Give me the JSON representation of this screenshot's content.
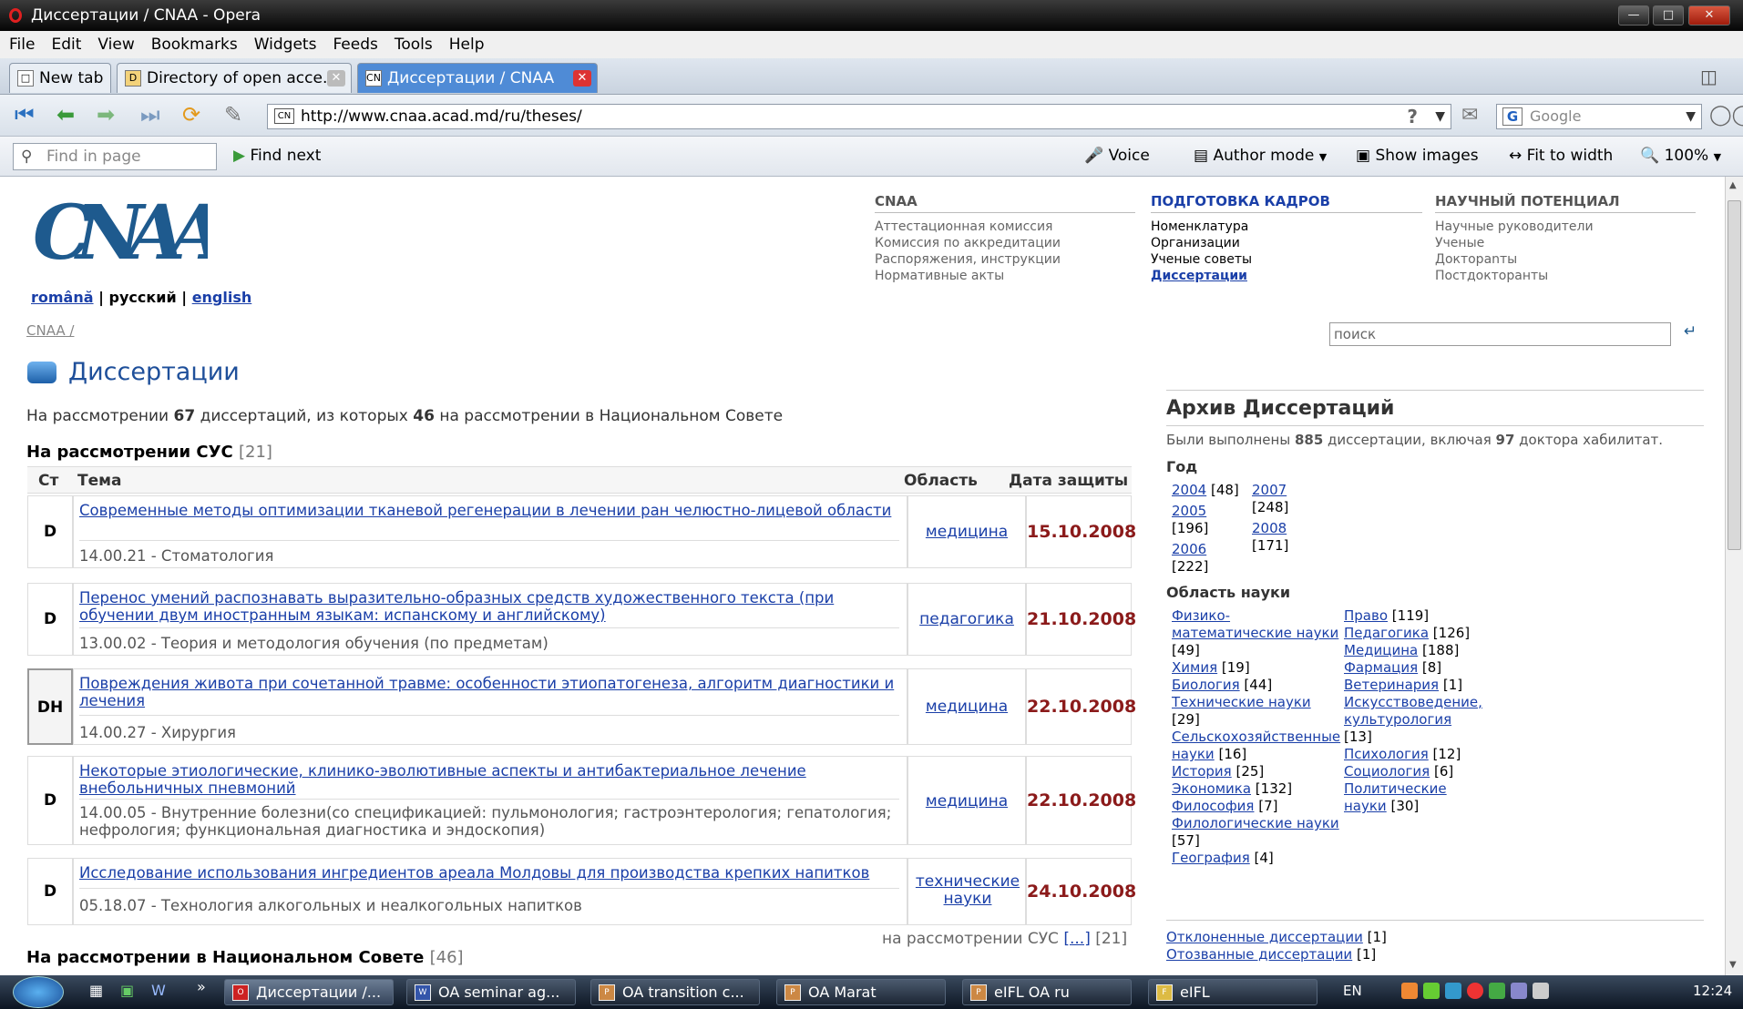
{
  "window": {
    "title": "Диссертации / CNAA - Opera"
  },
  "menu": [
    "File",
    "Edit",
    "View",
    "Bookmarks",
    "Widgets",
    "Feeds",
    "Tools",
    "Help"
  ],
  "tabs": [
    {
      "label": "New tab"
    },
    {
      "label": "Directory of open acce..."
    },
    {
      "label": "Диссертации / CNAA"
    }
  ],
  "nav": {
    "url": "http://www.cnaa.acad.md/ru/theses/",
    "search_placeholder": "Google"
  },
  "findbar": {
    "find_placeholder": "Find in page",
    "find_next": "Find next",
    "voice": "Voice",
    "author_mode": "Author mode",
    "show_images": "Show images",
    "fit_to_width": "Fit to width",
    "zoom": "100%"
  },
  "site": {
    "logo": "CNAA",
    "languages": {
      "ro": "română",
      "ru": "русский",
      "en": "english"
    },
    "breadcrumb": "CNAA /",
    "search_placeholder": "поиск",
    "menu_cols": [
      {
        "heading": "CNAA",
        "items": [
          "Аттестационная комиссия",
          "Комиссия по аккредитации",
          "Распоряжения, инструкции",
          "Нормативные акты"
        ]
      },
      {
        "heading": "ПОДГОТОВКА КАДРОВ",
        "items": [
          "Номенклатура",
          "Организации",
          "Ученые советы",
          "Диссертации"
        ]
      },
      {
        "heading": "НАУЧНЫЙ ПОТЕНЦИАЛ",
        "items": [
          "Научные руководители",
          "Ученые",
          "Доктораnты",
          "Постдокторанты"
        ]
      }
    ]
  },
  "main": {
    "title": "Диссертации",
    "summary": {
      "pre": "На рассмотрении ",
      "total": "67",
      "mid": " диссертаций, из которых ",
      "nc": "46",
      "post": " на рассмотрении в Национальном Совете"
    },
    "section1": {
      "title": "На рассмотрении СУС",
      "count": "[21]"
    },
    "columns": {
      "st": "Ст",
      "topic": "Тема",
      "area": "Область",
      "date": "Дата защиты"
    },
    "rows": [
      {
        "st": "D",
        "topic": "Современные методы оптимизации тканевой регенерации в лечении ран челюстно-лицевой области",
        "spec": "14.00.21 - Стоматология",
        "area": "медицина",
        "date": "15.10.2008"
      },
      {
        "st": "D",
        "topic": "Перенос умений распознавать выразительно-образных средств художественного текста (при обучении двум иностранным языкам: испанскому и английскому)",
        "spec": "13.00.02 - Теория и методология обучения (по предметам)",
        "area": "педагогика",
        "date": "21.10.2008"
      },
      {
        "st": "DH",
        "topic": "Повреждения живота при сочетанной травме: особенности этиопатогенеза, алгоритм диагностики и лечения",
        "spec": "14.00.27 - Хирургия",
        "area": "медицина",
        "date": "22.10.2008"
      },
      {
        "st": "D",
        "topic": "Некоторые этиологические, клинико-эволютивные аспекты и антибактериальное лечение внебольничных пневмоний",
        "spec": "14.00.05 - Внутренние болезни(со спецификацией: пульмонология; гастроэнтерология; гепатология; нефрология; функциональная диагностика и эндоскопия)",
        "area": "медицина",
        "date": "22.10.2008"
      },
      {
        "st": "D",
        "topic": "Исследование использования ингредиентов ареала Молдовы для производства крепких напитков",
        "spec": "05.18.07 - Технология алкогольных и неалкогольных напитков",
        "area": "технические науки",
        "date": "24.10.2008"
      }
    ],
    "more": {
      "pre": "на рассмотрении СУС ",
      "link": "[...]",
      "count": " [21]"
    },
    "section2": {
      "title": "На рассмотрении в Национальном Совете",
      "count": "[46]"
    }
  },
  "archive": {
    "title": "Архив Диссертаций",
    "summary": {
      "pre": "Были выполнены ",
      "total": "885",
      "mid": " диссертации, включая ",
      "hab": "97",
      "post": " доктора хабилитат."
    },
    "year_label": "Год",
    "years_col1": [
      {
        "y": "2004",
        "n": "[48]"
      },
      {
        "y": "2005",
        "n": "[196]"
      },
      {
        "y": "2006",
        "n": "[222]"
      }
    ],
    "years_col2": [
      {
        "y": "2007",
        "n": "[248]"
      },
      {
        "y": "2008",
        "n": "[171]"
      }
    ],
    "field_label": "Область науки",
    "fields_col1": [
      {
        "name": "Физико-математические науки",
        "n": "[49]"
      },
      {
        "name": "Химия",
        "n": "[19]"
      },
      {
        "name": "Биология",
        "n": "[44]"
      },
      {
        "name": "Технические науки",
        "n": "[29]"
      },
      {
        "name": "Сельскохозяйственные науки",
        "n": "[16]"
      },
      {
        "name": "История",
        "n": "[25]"
      },
      {
        "name": "Экономика",
        "n": "[132]"
      },
      {
        "name": "Философия",
        "n": "[7]"
      },
      {
        "name": "Филологические науки",
        "n": "[57]"
      },
      {
        "name": "География",
        "n": "[4]"
      }
    ],
    "fields_col2": [
      {
        "name": "Право",
        "n": "[119]"
      },
      {
        "name": "Педагогика",
        "n": "[126]"
      },
      {
        "name": "Медицина",
        "n": "[188]"
      },
      {
        "name": "Фармация",
        "n": "[8]"
      },
      {
        "name": "Ветеринария",
        "n": "[1]"
      },
      {
        "name": "Искусствоведение, культурология",
        "n": "[13]"
      },
      {
        "name": "Психология",
        "n": "[12]"
      },
      {
        "name": "Социология",
        "n": "[6]"
      },
      {
        "name": "Политические науки",
        "n": "[30]"
      }
    ],
    "rejected": {
      "label": "Отклоненные диссертации",
      "n": "[1]"
    },
    "withdrawn": {
      "label": "Отозванные диссертации",
      "n": "[1]"
    }
  },
  "taskbar": {
    "items": [
      "Диссертации /...",
      "OA seminar ag...",
      "OA transition c...",
      "OA Marat",
      "eIFL OA ru",
      "eIFL"
    ],
    "lang": "EN",
    "clock": "12:24"
  },
  "colors": {
    "link": "#1a3fa8",
    "date": "#8b1a1a",
    "accent_blue": "#1e5a8e"
  }
}
